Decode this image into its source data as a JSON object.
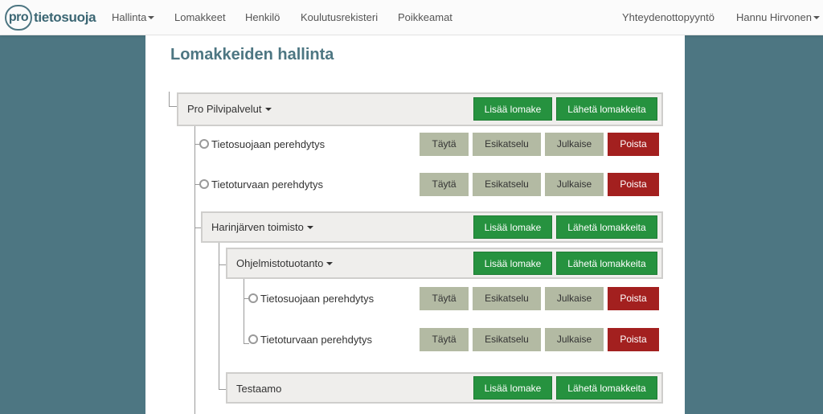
{
  "logo": {
    "badge": "pro",
    "name": "tietosuoja"
  },
  "nav": {
    "hallinta": "Hallinta",
    "lomakkeet": "Lomakkeet",
    "henkilo": "Henkilö",
    "koulutusrekisteri": "Koulutusrekisteri",
    "poikkeamat": "Poikkeamat",
    "contact": "Yhteydenottopyyntö",
    "user": "Hannu Hirvonen"
  },
  "page": {
    "title": "Lomakkeiden hallinta"
  },
  "actions": {
    "add_form": "Lisää lomake",
    "send_forms": "Lähetä lomakkeita",
    "fill": "Täytä",
    "preview": "Esikatselu",
    "publish": "Julkaise",
    "delete": "Poista"
  },
  "tree": {
    "root": {
      "name": "Pro Pilvipalvelut"
    },
    "root_forms": [
      "Tietosuojaan perehdytys",
      "Tietoturvaan perehdytys"
    ],
    "office": {
      "name": "Harinjärven toimisto"
    },
    "dept": {
      "name": "Ohjelmistotuotanto"
    },
    "dept_forms": [
      "Tietosuojaan perehdytys",
      "Tietoturvaan perehdytys"
    ],
    "test": {
      "name": "Testaamo"
    }
  },
  "colors": {
    "accent": "#4d7682",
    "green": "#26923f",
    "grey": "#b3baa3",
    "red": "#a3201f"
  }
}
